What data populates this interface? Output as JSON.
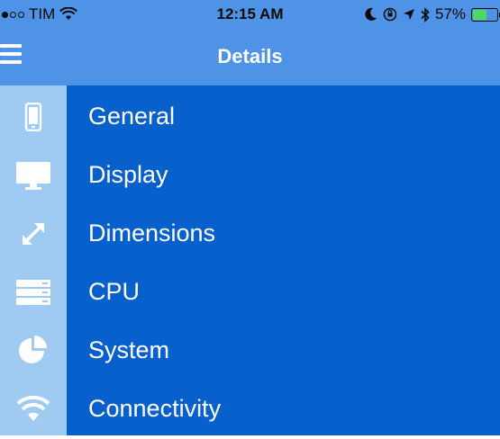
{
  "status_bar": {
    "carrier": "TIM",
    "time": "12:15 AM",
    "battery_percent": "57%",
    "battery_level": 0.57
  },
  "nav": {
    "title": "Details"
  },
  "menu": {
    "items": [
      {
        "label": "General",
        "icon": "phone-icon"
      },
      {
        "label": "Display",
        "icon": "monitor-icon"
      },
      {
        "label": "Dimensions",
        "icon": "resize-arrows-icon"
      },
      {
        "label": "CPU",
        "icon": "server-icon"
      },
      {
        "label": "System",
        "icon": "pie-chart-icon"
      },
      {
        "label": "Connectivity",
        "icon": "wifi-icon"
      }
    ]
  },
  "colors": {
    "nav_blue": "#4f93e6",
    "sidebar_blue": "#9fcaf2",
    "main_blue": "#0760cc",
    "battery_green": "#4cd964"
  }
}
